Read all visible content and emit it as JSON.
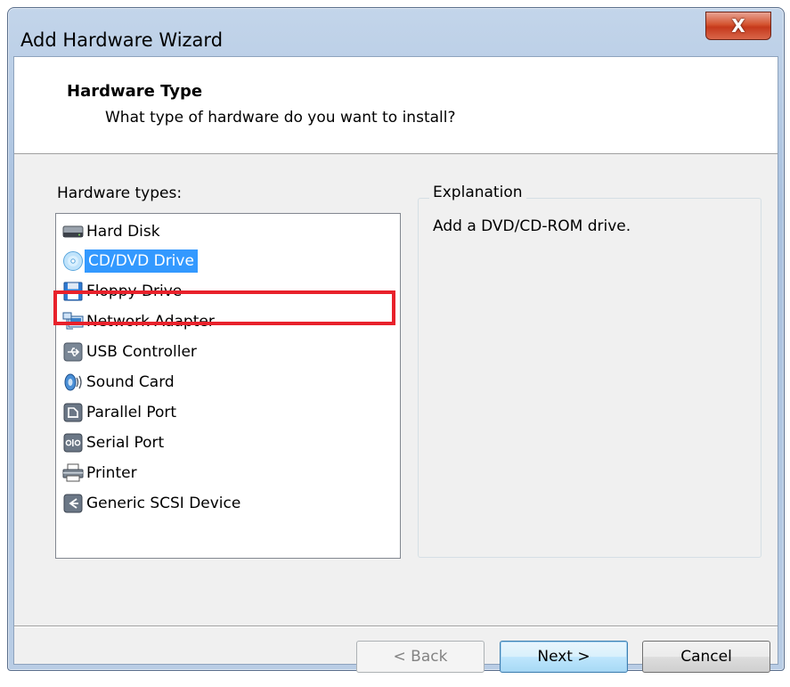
{
  "window": {
    "title": "Add Hardware Wizard",
    "close_glyph": "X"
  },
  "header": {
    "title": "Hardware Type",
    "subtitle": "What type of hardware do you want to install?"
  },
  "hardware_list": {
    "label": "Hardware types:",
    "selected_index": 1,
    "items": [
      {
        "label": "Hard Disk",
        "icon": "hard-disk-icon"
      },
      {
        "label": "CD/DVD Drive",
        "icon": "cd-dvd-icon"
      },
      {
        "label": "Floppy Drive",
        "icon": "floppy-icon"
      },
      {
        "label": "Network Adapter",
        "icon": "network-adapter-icon"
      },
      {
        "label": "USB Controller",
        "icon": "usb-icon"
      },
      {
        "label": "Sound Card",
        "icon": "sound-card-icon"
      },
      {
        "label": "Parallel Port",
        "icon": "parallel-port-icon"
      },
      {
        "label": "Serial Port",
        "icon": "serial-port-icon"
      },
      {
        "label": "Printer",
        "icon": "printer-icon"
      },
      {
        "label": "Generic SCSI Device",
        "icon": "scsi-device-icon"
      }
    ]
  },
  "explanation": {
    "legend": "Explanation",
    "text": "Add a DVD/CD-ROM drive."
  },
  "buttons": {
    "back": "< Back",
    "next": "Next >",
    "cancel": "Cancel"
  },
  "colors": {
    "selection": "#3399ff",
    "highlight_outline": "#e8212b"
  }
}
